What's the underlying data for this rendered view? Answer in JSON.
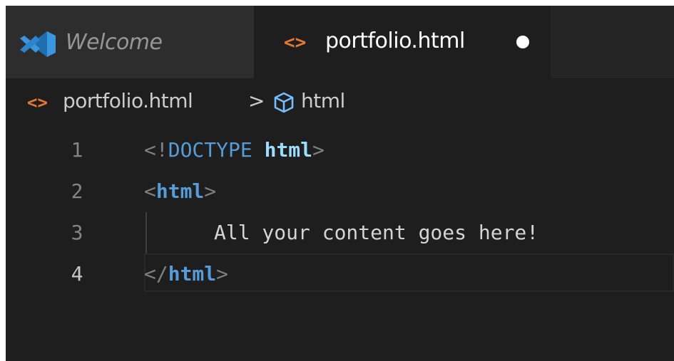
{
  "tabs": [
    {
      "label": "Welcome",
      "icon": "vscode-logo-icon",
      "active": false
    },
    {
      "label": "portfolio.html",
      "icon": "html-code-icon",
      "active": true,
      "unsaved": true
    }
  ],
  "breadcrumb": {
    "file_icon": "<>",
    "file": "portfolio.html",
    "separator": ">",
    "symbol": "html",
    "symbol_icon": "cube-icon"
  },
  "tab_icon_glyph": "<>",
  "editor": {
    "current_line": 4,
    "lines": [
      {
        "number": "1",
        "open": "<!",
        "keyword": "DOCTYPE",
        "space": " ",
        "attr": "html",
        "close": ">"
      },
      {
        "number": "2",
        "open": "<",
        "tag": "html",
        "close": ">"
      },
      {
        "number": "3",
        "text": "All your content goes here!"
      },
      {
        "number": "4",
        "open": "</",
        "tag": "html",
        "close": ">"
      }
    ]
  },
  "colors": {
    "background": "#1e1e1e",
    "tab_inactive": "#2d2d2d",
    "icon_orange": "#e37933",
    "keyword_blue": "#569cd6",
    "attribute_lightblue": "#9cdcfe",
    "vscode_blue": "#3a96dd"
  }
}
